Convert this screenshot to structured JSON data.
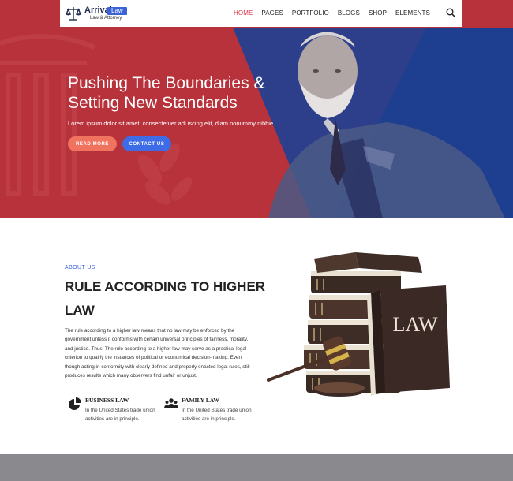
{
  "nav": {
    "logo_name": "Arrival",
    "logo_badge": "Law",
    "logo_sub": "Law & Attorney",
    "items": [
      "HOME",
      "PAGES",
      "PORTFOLIO",
      "BLOGS",
      "SHOP",
      "ELEMENTS"
    ],
    "active_index": 0
  },
  "hero": {
    "title_line1": "Pushing The Boundaries &",
    "title_line2": "Setting New Standards",
    "text": "Lorem ipsum dolor sit amet, consectetuer adi iscing elit, diam nonummy nibhie.",
    "read_more": "READ MORE",
    "contact": "CONTACT US"
  },
  "about": {
    "label": "ABOUT US",
    "title": "RULE ACCORDING TO HIGHER LAW",
    "paragraph": "The rule according to a higher law means that no law may be enforced by the government unless it conforms with certain universal principles of fairness, morality, and justice. Thus, The rule according to a higher law may serve as a practical legal criterion to qualify the instances of political or economical decision-making. Even though acting in conformity with clearly defined and properly enacted legal rules, still produces results which many observers find unfair or unjust.",
    "features": [
      {
        "title": "BUSINESS LAW",
        "text": "In the United States trade union activities are in principle."
      },
      {
        "title": "FAMILY LAW",
        "text": "In the United States trade union activities are in principle."
      }
    ],
    "book_text": "LAW"
  },
  "colors": {
    "red": "#b7323a",
    "blue": "#1e3f8f",
    "accent_pink": "#e2344a",
    "btn_orange": "#f0735f",
    "btn_blue": "#3d6ce6",
    "label_blue": "#3a63d6"
  }
}
